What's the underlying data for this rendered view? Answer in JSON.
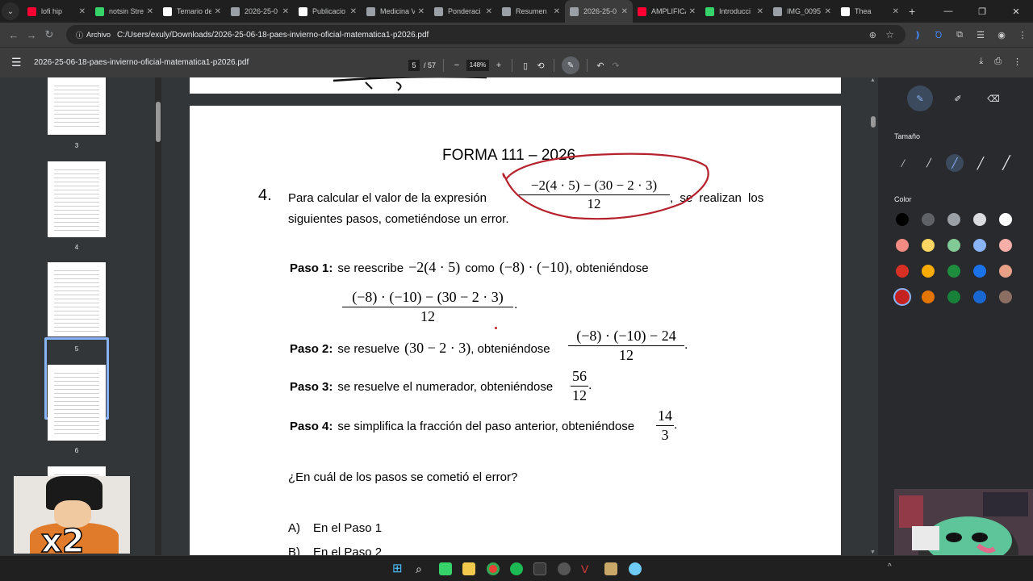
{
  "tabs": [
    {
      "title": "lofi hip",
      "favcolor": "#ff0033",
      "active": false
    },
    {
      "title": "notsin Stre",
      "favcolor": "#35d36a",
      "active": false
    },
    {
      "title": "Temario de",
      "favcolor": "#ffffff",
      "active": false
    },
    {
      "title": "2026-25-0",
      "favcolor": "#9aa0a6",
      "active": false
    },
    {
      "title": "Publicacio",
      "favcolor": "#ffffff",
      "active": false
    },
    {
      "title": "Medicina V",
      "favcolor": "#9aa0a6",
      "active": false
    },
    {
      "title": "Ponderaci",
      "favcolor": "#9aa0a6",
      "active": false
    },
    {
      "title": "Resumen",
      "favcolor": "#9aa0a6",
      "active": false
    },
    {
      "title": "2026-25-0",
      "favcolor": "#9aa0a6",
      "active": true
    },
    {
      "title": "AMPLIFICA",
      "favcolor": "#ff0033",
      "active": false
    },
    {
      "title": "Introducci",
      "favcolor": "#35d36a",
      "active": false
    },
    {
      "title": "IMG_0095",
      "favcolor": "#9aa0a6",
      "active": false
    },
    {
      "title": "Thea",
      "favcolor": "#ffffff",
      "active": false
    }
  ],
  "address": {
    "chip": "Archivo",
    "url": "C:/Users/exuly/Downloads/2026-25-06-18-paes-invierno-oficial-matematica1-p2026.pdf"
  },
  "pdf": {
    "title": "2026-25-06-18-paes-invierno-oficial-matematica1-p2026.pdf",
    "page": "5",
    "total": "/ 57",
    "zoom": "148%"
  },
  "thumbnails": [
    {
      "num": "3"
    },
    {
      "num": "4"
    },
    {
      "num": "5"
    },
    {
      "num": "6"
    }
  ],
  "page": {
    "forma": "FORMA 111 –  2026",
    "q_number": "4.",
    "q_line1_a": "Para calcular el valor de la expresión",
    "expr_num": "−2(4 · 5) − (30 − 2 · 3)",
    "expr_den": "12",
    "q_line1_b": ", se realizan los",
    "q_line2": "siguientes pasos, cometiéndose un error.",
    "paso1_label": "Paso 1:",
    "paso1_a": "se reescribe",
    "paso1_m1": "−2(4 · 5)",
    "paso1_b": "como",
    "paso1_m2": "(−8) · (−10)",
    "paso1_c": ", obteniéndose",
    "paso1_num": "(−8) · (−10) − (30 − 2 · 3)",
    "paso1_den": "12",
    "paso2_label": "Paso 2:",
    "paso2_a": "se resuelve",
    "paso2_m": "(30 − 2 · 3)",
    "paso2_b": ", obteniéndose",
    "paso2_num": "(−8) · (−10) − 24",
    "paso2_den": "12",
    "paso3_label": "Paso 3:",
    "paso3_a": "se resuelve el numerador, obteniéndose",
    "paso3_num": "56",
    "paso3_den": "12",
    "paso4_label": "Paso 4:",
    "paso4_a": "se simplifica la fracción del paso anterior, obteniéndose",
    "paso4_num": "14",
    "paso4_den": "3",
    "question": "¿En cuál de los pasos se cometió el error?",
    "optA_letter": "A)",
    "optA": "En el Paso 1",
    "optB_letter": "B)",
    "optB": "En el Paso 2"
  },
  "annot": {
    "size_label": "Tamaño",
    "color_label": "Color",
    "colors": [
      "#000000",
      "#5f6368",
      "#9aa0a6",
      "#dadce0",
      "#ffffff",
      "#f28b82",
      "#fdd663",
      "#81c995",
      "#8ab4f8",
      "#f6aea9",
      "#d93025",
      "#f9ab00",
      "#1e8e3e",
      "#1a73e8",
      "#e8a087",
      "#c5221f",
      "#e37400",
      "#188038",
      "#1967d2",
      "#8d6e63"
    ],
    "selected_color": "#c5221f"
  },
  "overlay": {
    "badge": "x2"
  },
  "annotation_stroke_color": "#b5222d"
}
